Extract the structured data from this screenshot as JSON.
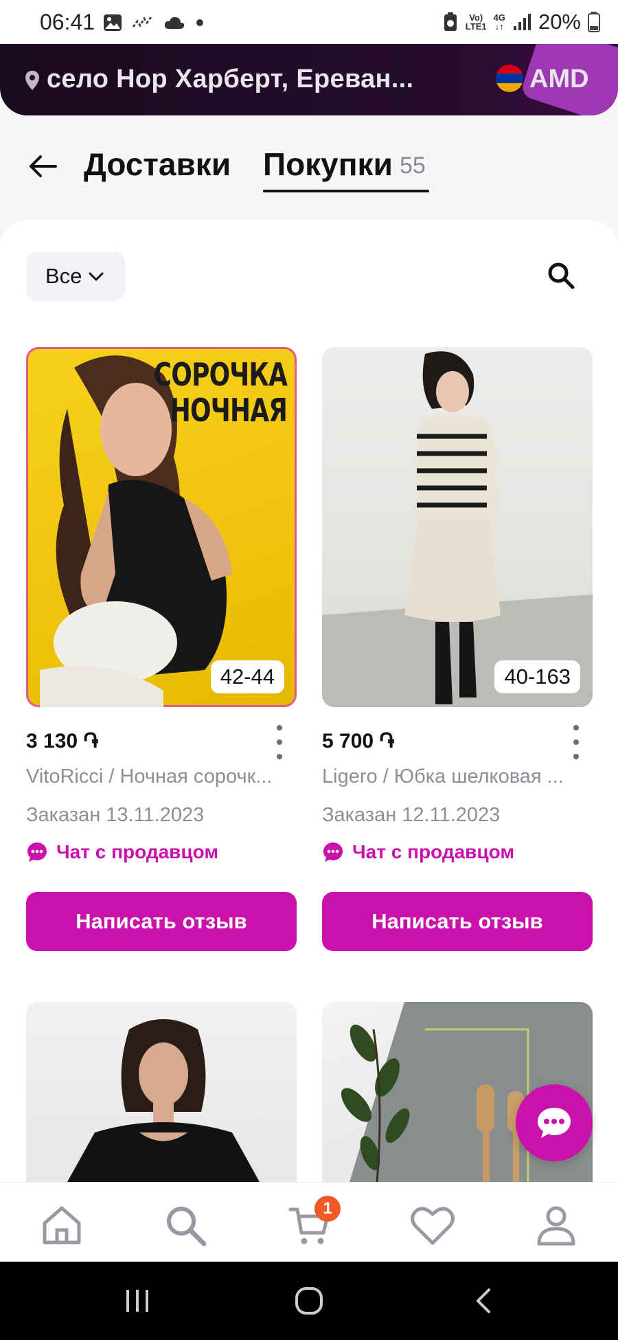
{
  "status_bar": {
    "time": "06:41",
    "battery": "20%",
    "volte": "Vo)\nLTE1",
    "net": "4G"
  },
  "location": {
    "text": "село Нор Харберт, Ереван...",
    "currency": "AMD"
  },
  "tabs": [
    {
      "label": "Доставки"
    },
    {
      "label": "Покупки",
      "count": "55"
    }
  ],
  "filter": {
    "label": "Все"
  },
  "products": [
    {
      "image_text": "СОРОЧКА\nНОЧНАЯ",
      "size": "42-44",
      "price": "3 130 ֏",
      "title": "VitoRicci / Ночная сорочк...",
      "ordered": "Заказан 13.11.2023",
      "chat": "Чат с продавцом",
      "review_button": "Написать отзыв"
    },
    {
      "size": "40-163",
      "price": "5 700 ֏",
      "title": "Ligero / Юбка шелковая ...",
      "ordered": "Заказан 12.11.2023",
      "chat": "Чат с продавцом",
      "review_button": "Написать отзыв"
    }
  ],
  "bottom_nav": {
    "cart_badge": "1"
  },
  "colors": {
    "accent": "#cb11ab",
    "badge": "#f15a24",
    "header_bg": "#1f0b24"
  }
}
